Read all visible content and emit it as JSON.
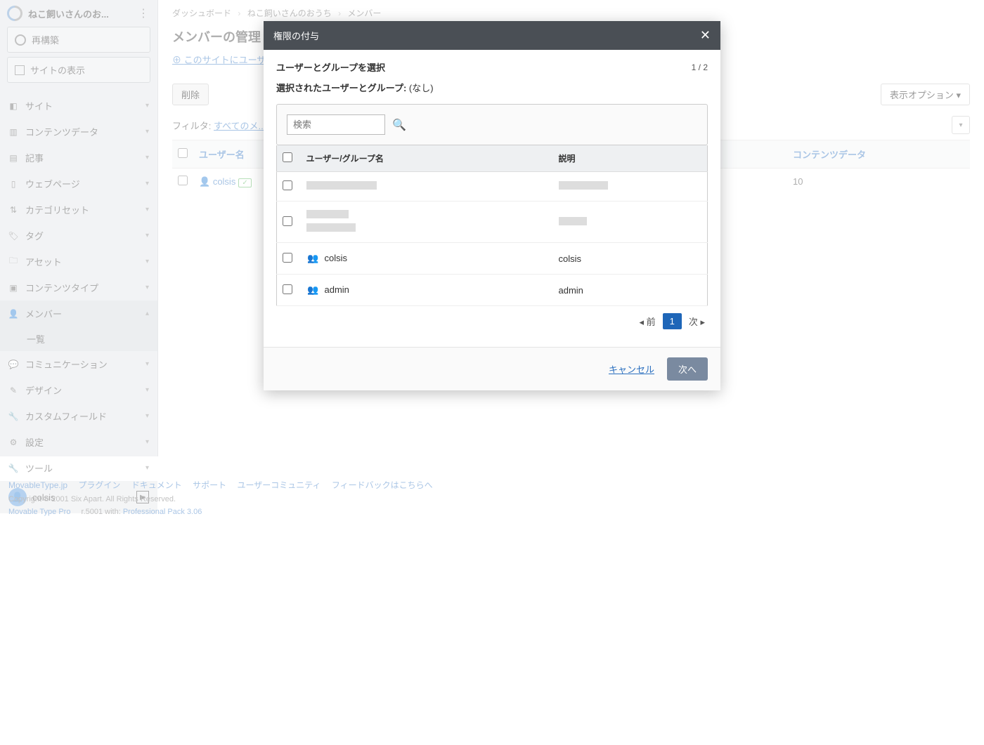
{
  "site": {
    "name": "ねこ飼いさんのお..."
  },
  "actions": {
    "rebuild": "再構築",
    "view_site": "サイトの表示"
  },
  "nav": [
    {
      "icon": "◧",
      "label": "サイト"
    },
    {
      "icon": "▥",
      "label": "コンテンツデータ"
    },
    {
      "icon": "▤",
      "label": "記事"
    },
    {
      "icon": "▯",
      "label": "ウェブページ"
    },
    {
      "icon": "⇅",
      "label": "カテゴリセット"
    },
    {
      "icon": "🏷",
      "label": "タグ"
    },
    {
      "icon": "🗀",
      "label": "アセット"
    },
    {
      "icon": "▣",
      "label": "コンテンツタイプ"
    },
    {
      "icon": "👤",
      "label": "メンバー",
      "expanded": true
    },
    {
      "icon": "💬",
      "label": "コミュニケーション"
    },
    {
      "icon": "✎",
      "label": "デザイン"
    },
    {
      "icon": "🔧",
      "label": "カスタムフィールド"
    },
    {
      "icon": "⚙",
      "label": "設定"
    },
    {
      "icon": "🔧",
      "label": "ツール"
    }
  ],
  "nav_sub": {
    "members_list": "一覧"
  },
  "user": {
    "name": "colsis"
  },
  "breadcrumb": {
    "dashboard": "ダッシュボード",
    "site": "ねこ飼いさんのおうち",
    "members": "メンバー"
  },
  "page": {
    "title": "メンバーの管理",
    "add_link": "このサイトにユーザー...",
    "delete_btn": "削除",
    "display_options": "表示オプション",
    "filter_label": "フィルタ:",
    "filter_value": "すべてのメ..."
  },
  "table": {
    "cols": {
      "username": "ユーザー名",
      "content_data": "コンテンツデータ"
    },
    "rows": [
      {
        "user": "colsis",
        "content_data": "10"
      }
    ]
  },
  "footer": {
    "links": [
      "MovableType.jp",
      "プラグイン",
      "ドキュメント",
      "サポート",
      "ユーザーコミュニティ",
      "フィードバックはこちらへ"
    ],
    "copy": "Copyright © 2001 Six Apart. All Rights Reserved.",
    "ver_pre": "Movable Type Pro",
    "ver_mid": " r.5001 with: ",
    "ver_link": "Professional Pack 3.06"
  },
  "modal": {
    "title": "権限の付与",
    "step_title": "ユーザーとグループを選択",
    "step_count": "1 / 2",
    "selected_label": "選択されたユーザーとグループ:",
    "selected_none": "(なし)",
    "search_placeholder": "検索",
    "cols": {
      "name": "ユーザー/グループ名",
      "desc": "説明"
    },
    "rows": [
      {
        "name": "colsis",
        "desc": "colsis"
      },
      {
        "name": "admin",
        "desc": "admin"
      }
    ],
    "pager": {
      "prev": "前",
      "page": "1",
      "next": "次"
    },
    "cancel": "キャンセル",
    "next_btn": "次へ"
  }
}
